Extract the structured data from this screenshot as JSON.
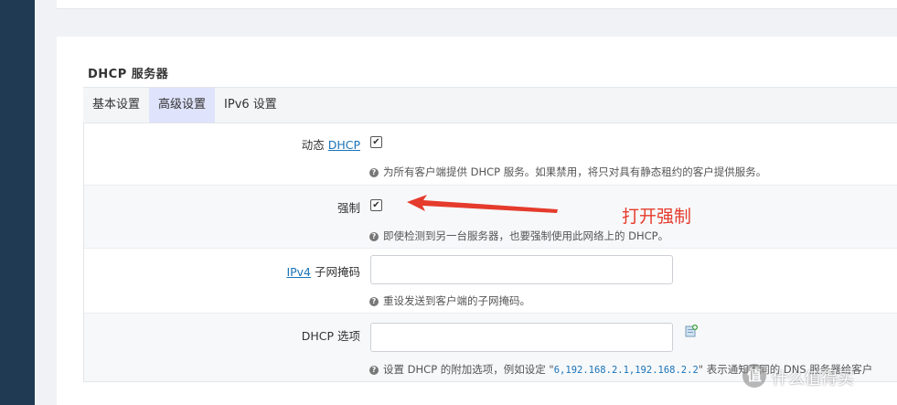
{
  "section": {
    "title": "DHCP 服务器"
  },
  "tabs": [
    {
      "label": "基本设置",
      "active": false
    },
    {
      "label": "高级设置",
      "active": true
    },
    {
      "label": "IPv6 设置",
      "active": false
    }
  ],
  "fields": {
    "dynamic_dhcp": {
      "label_prefix": "动态 ",
      "label_link": "DHCP",
      "checked": true,
      "help": "为所有客户端提供 DHCP 服务。如果禁用，将只对具有静态租约的客户提供服务。"
    },
    "force": {
      "label": "强制",
      "checked": true,
      "help": "即使检测到另一台服务器，也要强制使用此网络上的 DHCP。"
    },
    "netmask": {
      "label_link": "IPv4",
      "label_suffix": " 子网掩码",
      "value": "",
      "help": "重设发送到客户端的子网掩码。"
    },
    "dhcp_options": {
      "label": "DHCP 选项",
      "value": "",
      "help_prefix": "设置 DHCP 的附加选项，例如设定 \"",
      "help_code": "6,192.168.2.1,192.168.2.2",
      "help_suffix": "\" 表示通知不同的 DNS 服务器给客户"
    }
  },
  "annotation": {
    "text": "打开强制",
    "color": "#e53b2c"
  },
  "watermark": {
    "icon_text": "值",
    "text": "什么值得买"
  },
  "checkmark": "✔",
  "help_icon": "?",
  "colors": {
    "nav": "#1f3a52",
    "active_tab": "#dfe3fb",
    "link": "#1a73b8"
  }
}
